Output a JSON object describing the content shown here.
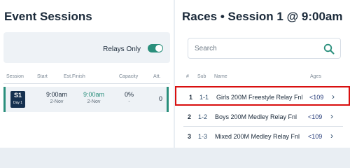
{
  "event_sessions": {
    "title": "Event Sessions",
    "relays_only_label": "Relays Only",
    "columns": [
      "Session",
      "Start",
      "Est.Finish",
      "Capacity",
      "Att."
    ],
    "rows": [
      {
        "session_label": "S1",
        "day_label": "Day 1",
        "start_time": "9:00am",
        "start_date": "2-Nov",
        "finish_time": "9:00am",
        "finish_date": "2-Nov",
        "capacity": "0%",
        "capacity_sub": "-",
        "attendance": "0"
      }
    ]
  },
  "races": {
    "title": "Races • Session 1 @ 9:00am",
    "search_placeholder": "Search",
    "columns": [
      "#",
      "Sub",
      "Name",
      "Ages"
    ],
    "rows": [
      {
        "num": "1",
        "sub": "1-1",
        "name": "Girls 200M Freestyle Relay Fnl",
        "ages": "<109",
        "chevron": "›"
      },
      {
        "num": "2",
        "sub": "1-2",
        "name": "Boys 200M Medley Relay Fnl",
        "ages": "<109",
        "chevron": "›"
      },
      {
        "num": "3",
        "sub": "1-3",
        "name": "Mixed 200M Medley Relay Fnl",
        "ages": "<109",
        "chevron": "›"
      }
    ]
  },
  "colors": {
    "accent": "#2a8f7c",
    "navy": "#15304f",
    "highlight": "#d90f0f",
    "background": "#e9eef3"
  },
  "icons": {
    "search": "search-icon",
    "chevron": "chevron-right-icon",
    "toggle": "toggle-switch"
  }
}
